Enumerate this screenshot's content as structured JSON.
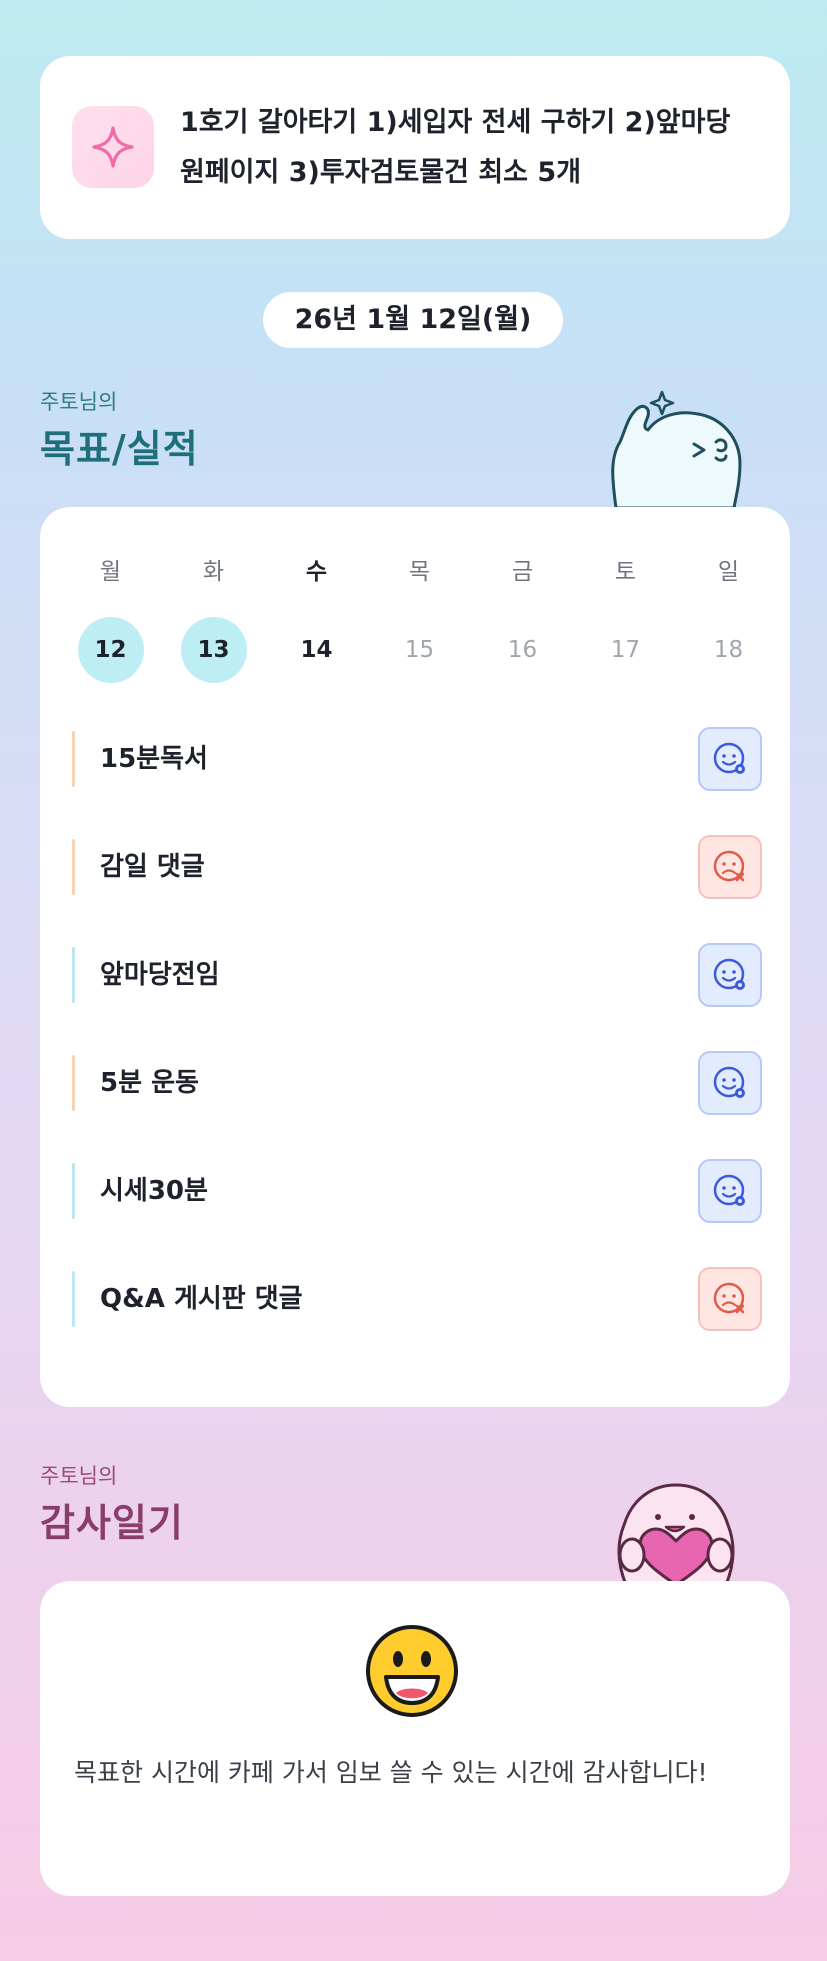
{
  "goal_banner": {
    "text": "1호기 갈아타기 1)세입자 전세 구하기 2)앞마당 원페이지 3)투자검토물건 최소 5개",
    "icon": "sparkle-icon"
  },
  "date": "26년 1월 12일(월)",
  "goals_section": {
    "subtitle": "주토님의",
    "title": "목표/실적"
  },
  "week": {
    "days": [
      "월",
      "화",
      "수",
      "목",
      "금",
      "토",
      "일"
    ],
    "dates": [
      "12",
      "13",
      "14",
      "15",
      "16",
      "17",
      "18"
    ]
  },
  "tasks": [
    {
      "label": "15분독서",
      "status": "success"
    },
    {
      "label": "감일 댓글",
      "status": "fail"
    },
    {
      "label": "앞마당전임",
      "status": "success"
    },
    {
      "label": "5분 운동",
      "status": "success"
    },
    {
      "label": "시세30분",
      "status": "success"
    },
    {
      "label": "Q&A 게시판 댓글",
      "status": "fail"
    }
  ],
  "diary_section": {
    "subtitle": "주토님의",
    "title": "감사일기",
    "emoji": "grinning-face-icon",
    "text": "목표한 시간에 카페 가서 임보 쓸 수 있는 시간에 감사합니다!"
  },
  "colors": {
    "success_bg": "#e3ebff",
    "success_icon": "#3b5bdb",
    "fail_bg": "#ffe6e3",
    "fail_icon": "#e25b4a",
    "done_date": "#bdeef4",
    "goals_title": "#1f6f7a",
    "diary_title": "#8a3c6c"
  }
}
